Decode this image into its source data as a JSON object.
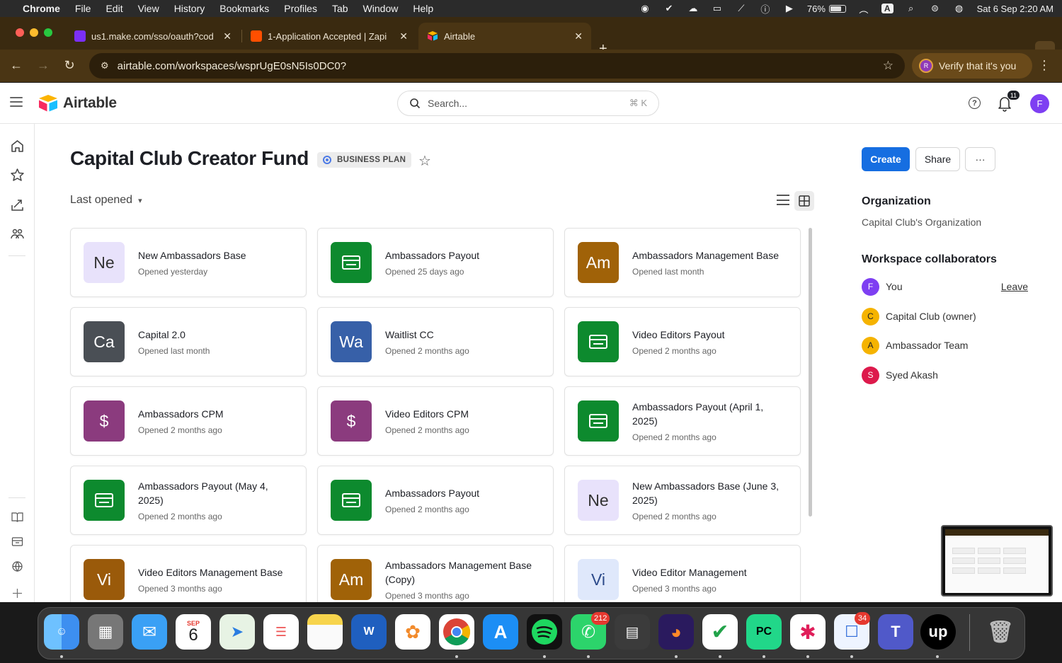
{
  "menubar": {
    "app": "Chrome",
    "items": [
      "File",
      "Edit",
      "View",
      "History",
      "Bookmarks",
      "Profiles",
      "Tab",
      "Window",
      "Help"
    ],
    "battery": "76%",
    "input_badge": "A",
    "battery_level": 0.76,
    "datetime": "Sat 6 Sep  2:20 AM"
  },
  "browser": {
    "tabs": [
      {
        "title": "us1.make.com/sso/oauth?cod",
        "favicon_color": "#7b2ff7"
      },
      {
        "title": "1-Application Accepted | Zapi",
        "favicon_color": "#ff4f00"
      },
      {
        "title": "Airtable",
        "favicon_color": "#fcb400"
      }
    ],
    "new_tab": "+",
    "url": "airtable.com/workspaces/wsprUgE0sN5Is0DC0?",
    "verify_label": "Verify that it's you",
    "verify_avatar": "R"
  },
  "header": {
    "brand": "Airtable",
    "search_placeholder": "Search...",
    "search_shortcut": "⌘ K",
    "help": "?",
    "notification_count": "11",
    "user_initial": "F"
  },
  "workspace": {
    "title": "Capital Club Creator Fund",
    "plan_badge": "BUSINESS PLAN",
    "sort_label": "Last opened",
    "create_label": "Create",
    "share_label": "Share",
    "more_label": "···"
  },
  "bases": [
    {
      "name": "New Ambassadors Base",
      "opened": "Opened yesterday",
      "icon": "Ne",
      "color": "#e8e2fb",
      "fg": "#333"
    },
    {
      "name": "Ambassadors Payout",
      "opened": "Opened 25 days ago",
      "icon": "table-icon",
      "color": "#0d8a2e",
      "fg": "#fff"
    },
    {
      "name": "Ambassadors Management Base",
      "opened": "Opened last month",
      "icon": "Am",
      "color": "#a06208",
      "fg": "#fff"
    },
    {
      "name": "Capital 2.0",
      "opened": "Opened last month",
      "icon": "Ca",
      "color": "#4a4f55",
      "fg": "#fff"
    },
    {
      "name": "Waitlist CC",
      "opened": "Opened 2 months ago",
      "icon": "Wa",
      "color": "#3760a8",
      "fg": "#fff"
    },
    {
      "name": "Video Editors Payout",
      "opened": "Opened 2 months ago",
      "icon": "table-icon",
      "color": "#0d8a2e",
      "fg": "#fff"
    },
    {
      "name": "Ambassadors CPM",
      "opened": "Opened 2 months ago",
      "icon": "$",
      "color": "#8b3b7e",
      "fg": "#fff"
    },
    {
      "name": "Video Editors CPM",
      "opened": "Opened 2 months ago",
      "icon": "$",
      "color": "#8b3b7e",
      "fg": "#fff"
    },
    {
      "name": "Ambassadors Payout (April 1, 2025)",
      "opened": "Opened 2 months ago",
      "icon": "table-icon",
      "color": "#0d8a2e",
      "fg": "#fff"
    },
    {
      "name": "Ambassadors Payout (May 4, 2025)",
      "opened": "Opened 2 months ago",
      "icon": "table-icon",
      "color": "#0d8a2e",
      "fg": "#fff"
    },
    {
      "name": "Ambassadors Payout",
      "opened": "Opened 2 months ago",
      "icon": "table-icon",
      "color": "#0d8a2e",
      "fg": "#fff"
    },
    {
      "name": "New Ambassadors Base (June 3, 2025)",
      "opened": "Opened 2 months ago",
      "icon": "Ne",
      "color": "#e8e2fb",
      "fg": "#333"
    },
    {
      "name": "Video Editors Management Base",
      "opened": "Opened 3 months ago",
      "icon": "Vi",
      "color": "#9a5a0a",
      "fg": "#fff"
    },
    {
      "name": "Ambassadors Management Base (Copy)",
      "opened": "Opened 3 months ago",
      "icon": "Am",
      "color": "#a06208",
      "fg": "#fff"
    },
    {
      "name": "Video Editor Management",
      "opened": "Opened 3 months ago",
      "icon": "Vi",
      "color": "#dfe8fb",
      "fg": "#2c4a8a"
    }
  ],
  "sidebar": {
    "org_heading": "Organization",
    "org_name": "Capital Club's Organization",
    "collab_heading": "Workspace collaborators",
    "leave_label": "Leave",
    "collaborators": [
      {
        "initial": "F",
        "name": "You",
        "color": "#7e3ff2"
      },
      {
        "initial": "C",
        "name": "Capital Club (owner)",
        "color": "#f5b300"
      },
      {
        "initial": "A",
        "name": "Ambassador Team",
        "color": "#f5b300"
      },
      {
        "initial": "S",
        "name": "Syed Akash",
        "color": "#dd1a4c"
      }
    ]
  },
  "dock": {
    "calendar_month": "SEP",
    "calendar_day": "6",
    "whatsapp_badge": "212",
    "chat_badge": "34",
    "pycharm_label": "PC",
    "upwork_label": "up",
    "word_label": "W"
  }
}
